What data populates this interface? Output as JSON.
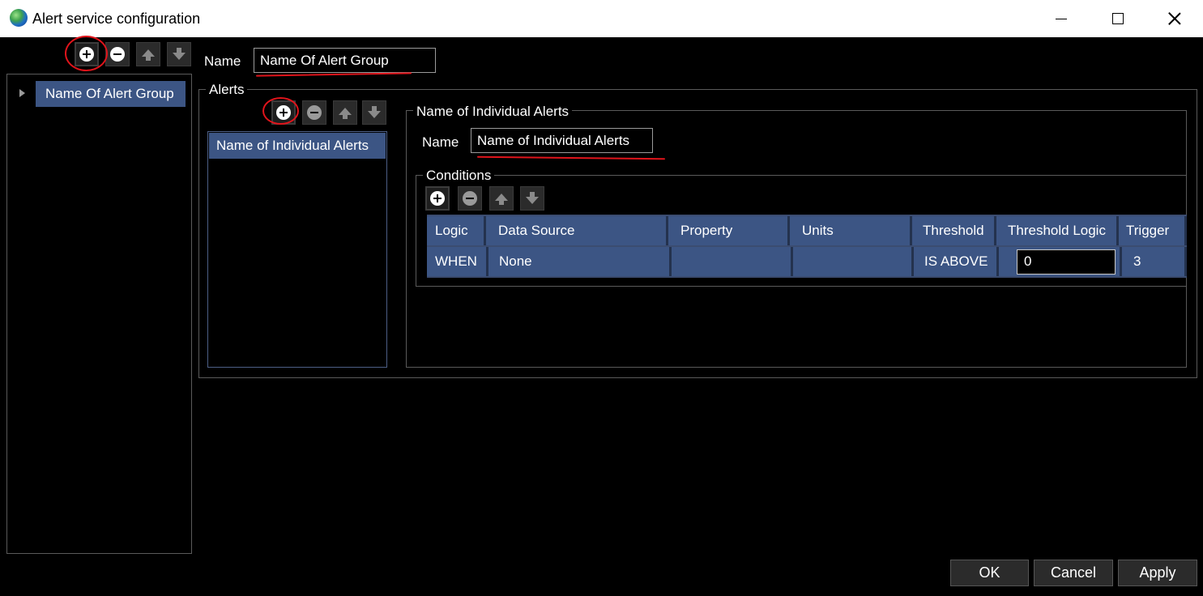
{
  "window": {
    "title": "Alert service configuration"
  },
  "tree": {
    "items": [
      {
        "label": "Name Of Alert Group"
      }
    ]
  },
  "group": {
    "name_label": "Name",
    "name_value": "Name Of Alert Group"
  },
  "alerts": {
    "legend": "Alerts",
    "items": [
      {
        "label": "Name of Individual Alerts"
      }
    ]
  },
  "alert_detail": {
    "legend": "Name of Individual Alerts",
    "name_label": "Name",
    "name_value": "Name of Individual Alerts"
  },
  "conditions": {
    "legend": "Conditions",
    "columns": [
      "Logic",
      "Data Source",
      "Property",
      "Units",
      "Threshold",
      "Threshold Logic",
      "Trigger"
    ],
    "rows": [
      {
        "logic": "WHEN",
        "data_source": "None",
        "property": "",
        "units": "",
        "threshold": "IS ABOVE",
        "threshold_logic": "0",
        "trigger": "3"
      }
    ]
  },
  "buttons": {
    "ok": "OK",
    "cancel": "Cancel",
    "apply": "Apply"
  },
  "colors": {
    "selection": "#3c5584",
    "annotation": "#e0141b",
    "background": "#000000"
  }
}
